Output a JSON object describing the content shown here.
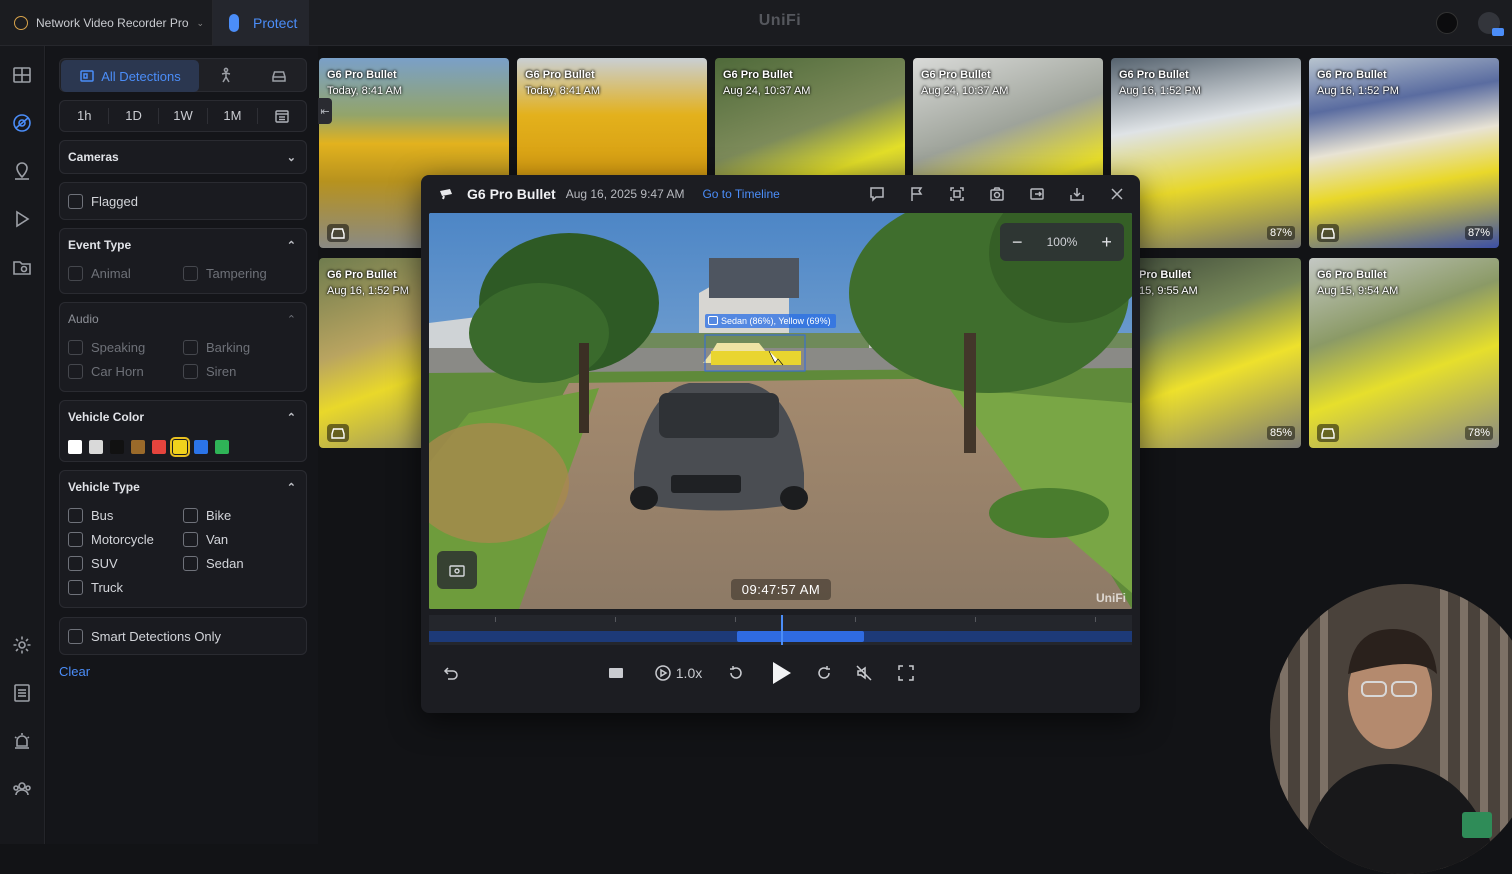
{
  "topbar": {
    "app_switcher_label": "Network Video Recorder Pro",
    "active_app": "Protect",
    "brand": "UniFi"
  },
  "rail": {
    "icons": [
      "grid-icon",
      "detections-icon",
      "map-icon",
      "play-icon",
      "folder-camera-icon",
      "gear-icon",
      "list-icon",
      "alarm-icon",
      "users-icon"
    ],
    "active": "detections-icon"
  },
  "filters": {
    "tabs": [
      {
        "label": "All Detections",
        "icon": "detections-icon",
        "active": true
      },
      {
        "label": "",
        "icon": "person-icon",
        "active": false
      },
      {
        "label": "",
        "icon": "vehicle-icon",
        "active": false
      }
    ],
    "ranges": [
      "1h",
      "1D",
      "1W",
      "1M"
    ],
    "cameras_label": "Cameras",
    "flagged_label": "Flagged",
    "event_type": {
      "title": "Event Type",
      "options": [
        "Animal",
        "Tampering"
      ]
    },
    "audio": {
      "title": "Audio",
      "options": [
        "Speaking",
        "Barking",
        "Car Horn",
        "Siren"
      ]
    },
    "vehicle_color": {
      "title": "Vehicle Color",
      "colors": [
        "#ffffff",
        "#d9d9d9",
        "#111111",
        "#9a6a2a",
        "#e5443d",
        "#f0d21c",
        "#2b74e8",
        "#2fb457"
      ],
      "selected": "#f0d21c"
    },
    "vehicle_type": {
      "title": "Vehicle Type",
      "options": [
        "Bus",
        "Bike",
        "Motorcycle",
        "Van",
        "SUV",
        "Sedan",
        "Truck"
      ]
    },
    "smart_only_label": "Smart Detections Only",
    "clear_label": "Clear"
  },
  "tiles": [
    {
      "camera": "G6 Pro Bullet",
      "time": "Today, 8:41 AM",
      "pct": ""
    },
    {
      "camera": "G6 Pro Bullet",
      "time": "Today, 8:41 AM",
      "pct": ""
    },
    {
      "camera": "G6 Pro Bullet",
      "time": "Aug 24, 10:37 AM",
      "pct": ""
    },
    {
      "camera": "G6 Pro Bullet",
      "time": "Aug 24, 10:37 AM",
      "pct": ""
    },
    {
      "camera": "G6 Pro Bullet",
      "time": "Aug 16, 1:52 PM",
      "pct": "87%"
    },
    {
      "camera": "G6 Pro Bullet",
      "time": "Aug 16, 1:52 PM",
      "pct": "87%"
    },
    {
      "camera": "G6 Pro Bullet",
      "time": "Aug 16, 1:52 PM",
      "pct": ""
    },
    {
      "camera": "Pro Bullet",
      "time": "15, 9:55 AM",
      "pct": "85%"
    },
    {
      "camera": "G6 Pro Bullet",
      "time": "Aug 15, 9:54 AM",
      "pct": "78%"
    }
  ],
  "modal": {
    "camera": "G6 Pro Bullet",
    "date": "Aug 16, 2025 9:47 AM",
    "goto_label": "Go to Timeline",
    "header_icons": [
      "comment-icon",
      "flag-icon",
      "scan-icon",
      "snapshot-icon",
      "export-icon",
      "download-icon",
      "close-icon"
    ],
    "zoom_level": "100%",
    "detection_label": "Sedan (86%), Yellow (69%)",
    "timecode": "09:47:57 AM",
    "watermark": "UniFi",
    "playback_speed": "1.0x",
    "playhead_fraction": 0.5
  }
}
